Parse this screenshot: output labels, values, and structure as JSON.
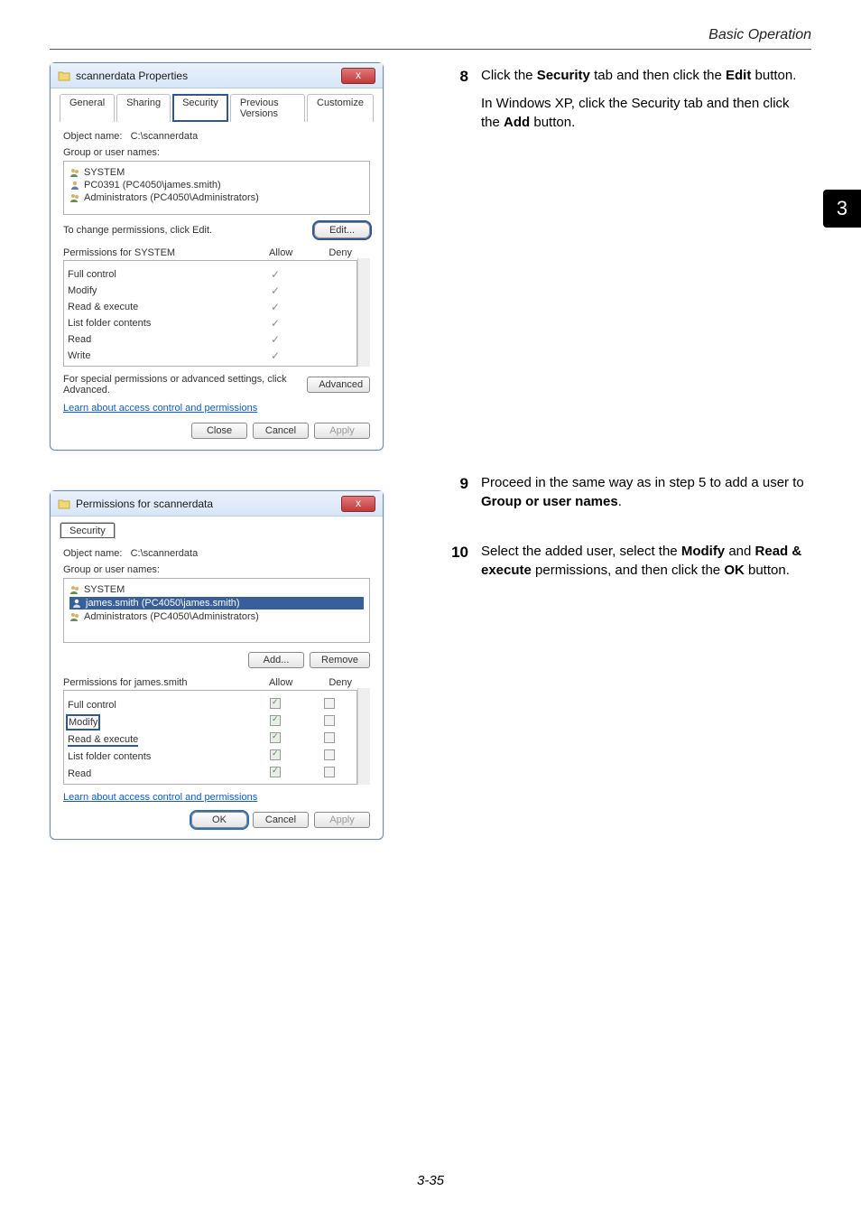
{
  "page": {
    "header": "Basic Operation",
    "chapter": "3",
    "number": "3-35"
  },
  "dialog1": {
    "title": "scannerdata Properties",
    "close": "x",
    "tabs": [
      "General",
      "Sharing",
      "Security",
      "Previous Versions",
      "Customize"
    ],
    "object_label": "Object name:",
    "object_value": "C:\\scannerdata",
    "group_label": "Group or user names:",
    "users": [
      "SYSTEM",
      "PC0391 (PC4050\\james.smith)",
      "Administrators (PC4050\\Administrators)"
    ],
    "edit_label": "To change permissions, click Edit.",
    "edit_btn": "Edit...",
    "perms_for": "Permissions for SYSTEM",
    "allow": "Allow",
    "deny": "Deny",
    "perms": [
      "Full control",
      "Modify",
      "Read & execute",
      "List folder contents",
      "Read",
      "Write"
    ],
    "special": "For special permissions or advanced settings, click Advanced.",
    "advanced": "Advanced",
    "learn": "Learn about access control and permissions",
    "btn_close": "Close",
    "btn_cancel": "Cancel",
    "btn_apply": "Apply"
  },
  "dialog2": {
    "title": "Permissions for scannerdata",
    "close": "x",
    "tab": "Security",
    "object_label": "Object name:",
    "object_value": "C:\\scannerdata",
    "group_label": "Group or user names:",
    "users": [
      "SYSTEM",
      "james.smith (PC4050\\james.smith)",
      "Administrators (PC4050\\Administrators)"
    ],
    "add": "Add...",
    "remove": "Remove",
    "perms_for": "Permissions for  james.smith",
    "allow": "Allow",
    "deny": "Deny",
    "perms": [
      "Full control",
      "Modify",
      "Read & execute",
      "List folder contents",
      "Read"
    ],
    "learn": "Learn about access control and permissions",
    "btn_ok": "OK",
    "btn_cancel": "Cancel",
    "btn_apply": "Apply"
  },
  "steps": [
    {
      "num": "8",
      "t1": "Click the",
      "b1": "Security",
      "t2": "tab and then click the",
      "b2": "Edit",
      "t3": "button.",
      "t4": "In Windows XP, click the Security tab and then click the",
      "b3": "Add",
      "t5": "button."
    },
    {
      "num": "9",
      "t1": "Proceed in the same way as in step 5 to add a user to",
      "b1": "Group or user names",
      "t2": "."
    },
    {
      "num": "10",
      "t1": "Select the added user, select the",
      "b1": "Modify",
      "t2": "and",
      "b2": "Read & execute",
      "t3": "permissions, and then click the",
      "b3": "OK",
      "t4": "button."
    }
  ]
}
